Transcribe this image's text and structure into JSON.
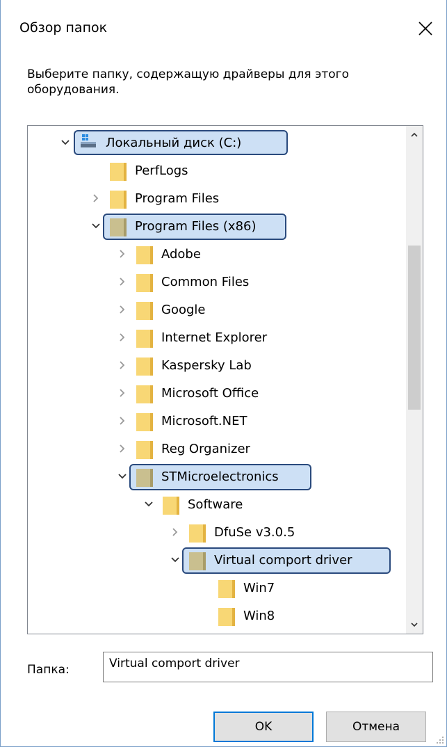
{
  "dialog": {
    "title": "Обзор папок",
    "instruction": "Выберите папку, содержащую драйверы для этого оборудования.",
    "folder_label": "Папка:",
    "folder_value": "Virtual comport driver",
    "ok_label": "OK",
    "cancel_label": "Отмена"
  },
  "tree": {
    "items": [
      {
        "label": "Локальный диск (C:)"
      },
      {
        "label": "PerfLogs"
      },
      {
        "label": "Program Files"
      },
      {
        "label": "Program Files (x86)"
      },
      {
        "label": "Adobe"
      },
      {
        "label": "Common Files"
      },
      {
        "label": "Google"
      },
      {
        "label": "Internet Explorer"
      },
      {
        "label": "Kaspersky Lab"
      },
      {
        "label": "Microsoft Office"
      },
      {
        "label": "Microsoft.NET"
      },
      {
        "label": "Reg Organizer"
      },
      {
        "label": "STMicroelectronics"
      },
      {
        "label": "Software"
      },
      {
        "label": "DfuSe v3.0.5"
      },
      {
        "label": "Virtual comport driver"
      },
      {
        "label": "Win7"
      },
      {
        "label": "Win8"
      }
    ]
  },
  "colors": {
    "folder_yellow": "#f8d775",
    "folder_gray": "#c9bf8f",
    "highlight_bg": "#cde0f5",
    "highlight_border": "#2a4a7d",
    "ok_border": "#0078d7"
  }
}
